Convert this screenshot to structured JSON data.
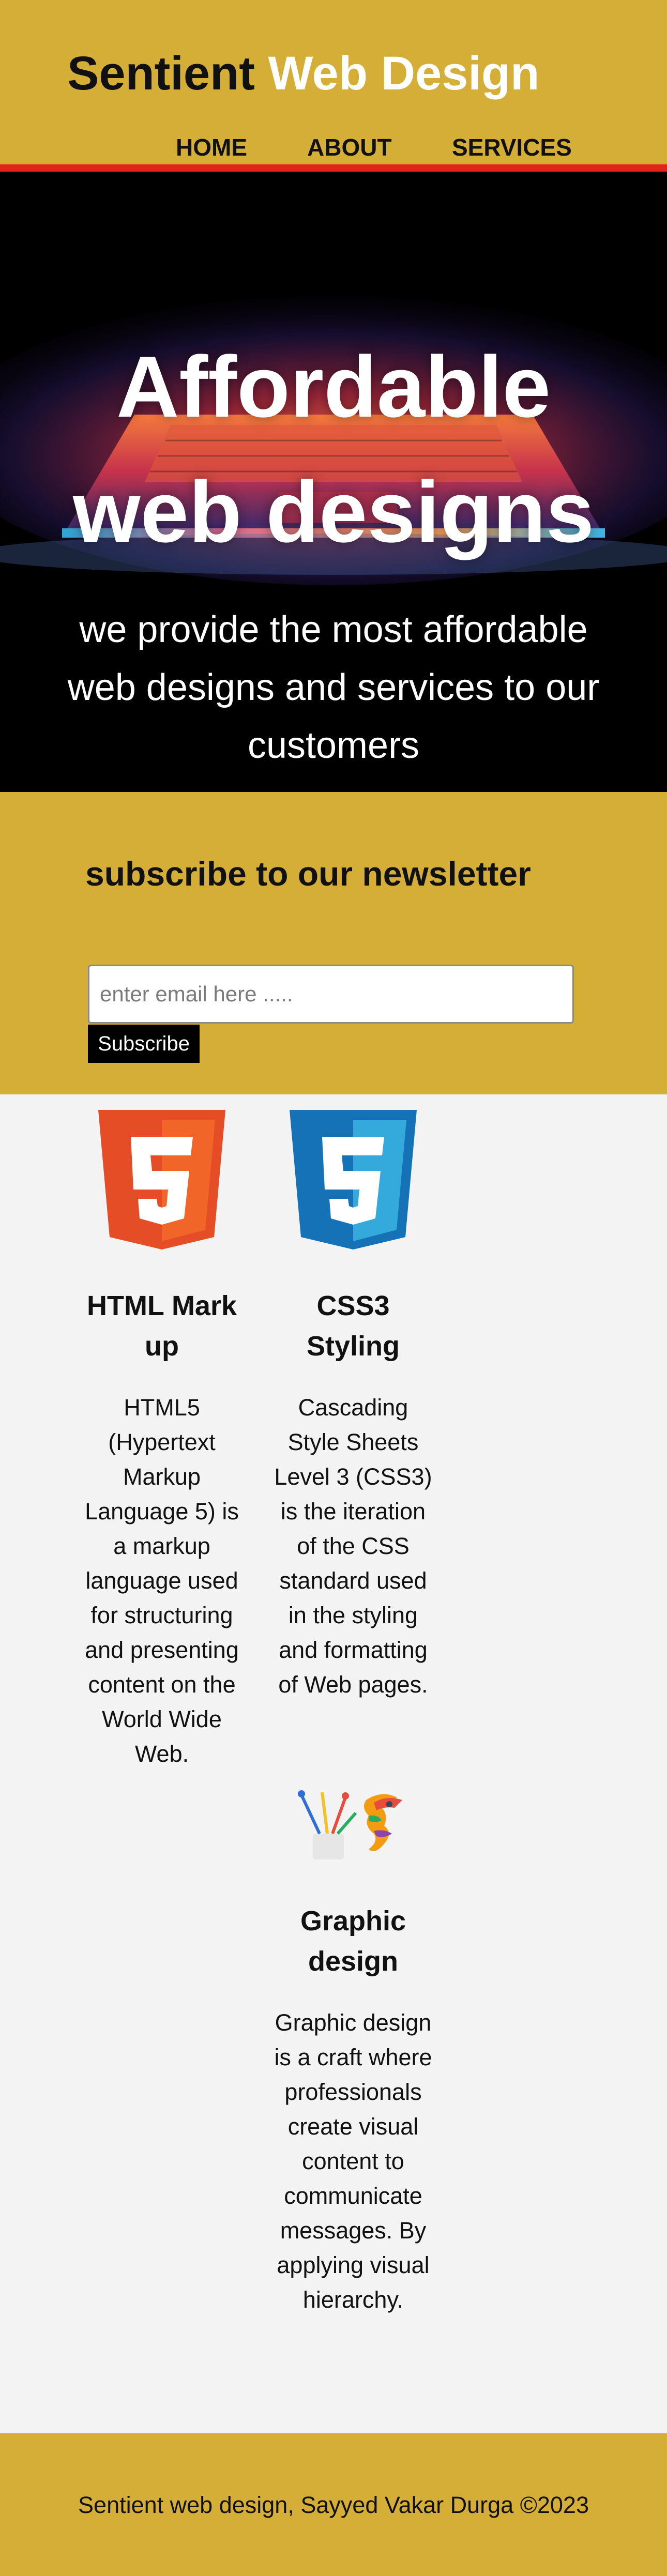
{
  "header": {
    "brand_part1": "Sentient",
    "brand_part2": "Web Design",
    "nav": [
      "HOME",
      "ABOUT",
      "SERVICES"
    ]
  },
  "hero": {
    "title_line1": "Affordable",
    "title_line2": "web designs",
    "text": "we provide the most affordable web designs and services to our customers"
  },
  "newsletter": {
    "title": "subscribe to our newsletter",
    "email_placeholder": "enter email here .....",
    "button_label": "Subscribe"
  },
  "features": [
    {
      "icon": "html5-logo-icon",
      "title": "HTML Mark up",
      "description": "HTML5 (Hypertext Markup Language 5) is a markup language used for structuring and presenting content on the World Wide Web."
    },
    {
      "icon": "css3-logo-icon",
      "title": "CSS3 Styling",
      "description": "Cascading Style Sheets Level 3 (CSS3) is the iteration of the CSS standard used in the styling and formatting of Web pages."
    },
    {
      "icon": "graphic-design-icon",
      "title": "Graphic design",
      "description": "Graphic design is a craft where professionals create visual content to communicate messages. By applying visual hierarchy."
    }
  ],
  "footer": {
    "text": "Sentient web design, Sayyed Vakar Durga ©2023"
  },
  "colors": {
    "brand_gold": "#d4ae36",
    "accent_red": "#e3241b",
    "html5_orange": "#e44d26",
    "css3_blue": "#1572b6"
  }
}
